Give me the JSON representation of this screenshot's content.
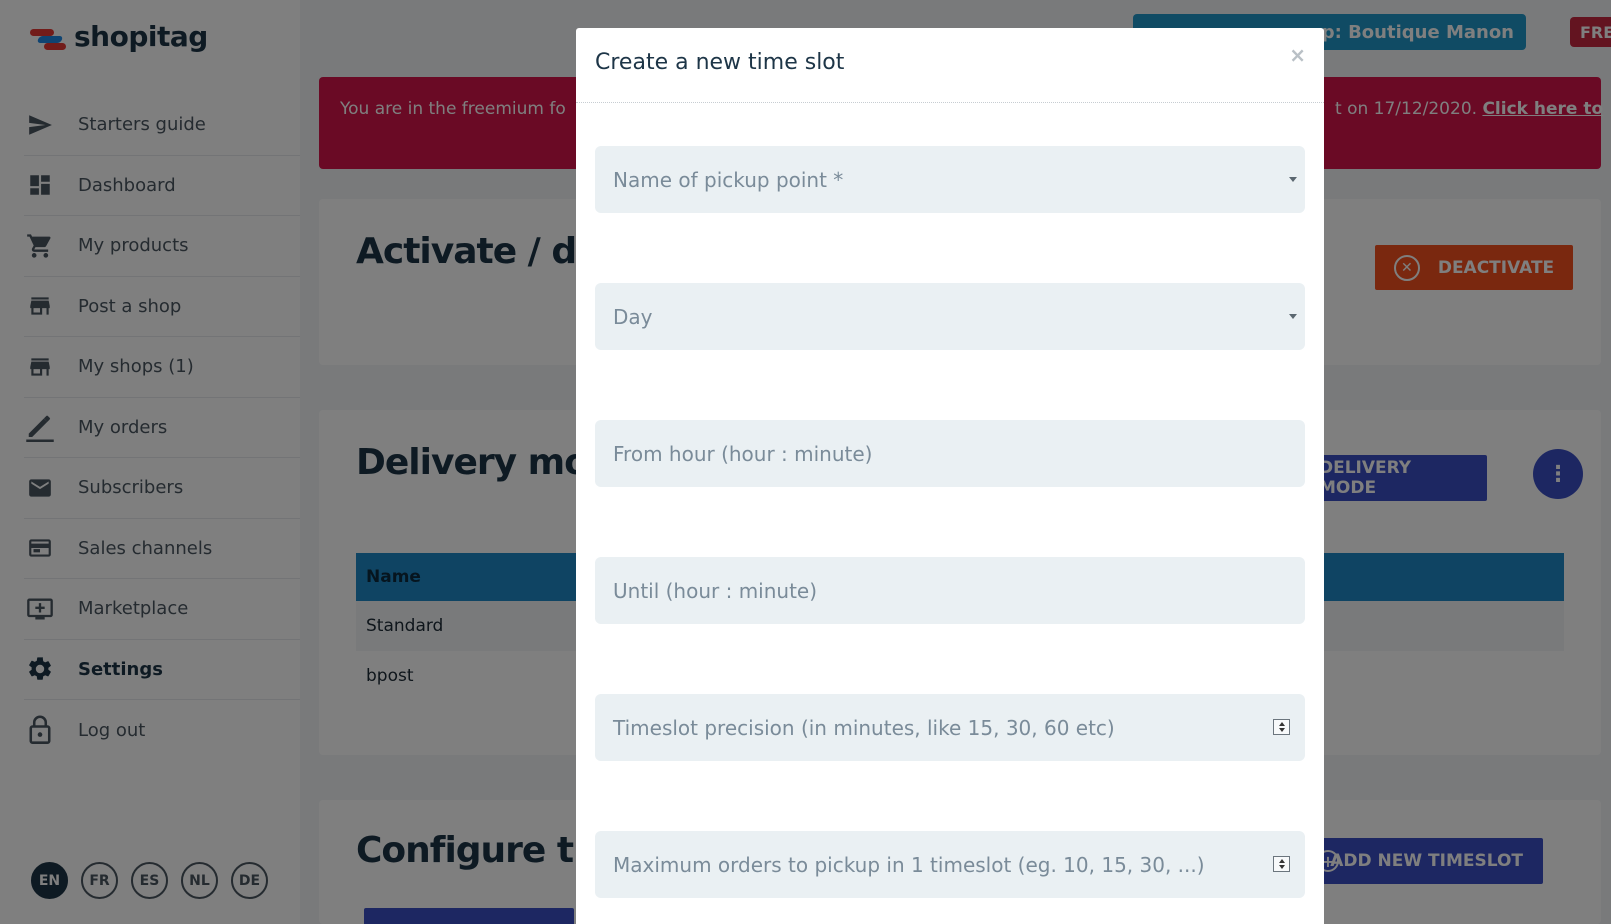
{
  "brand": {
    "name": "shopitag"
  },
  "sidebar": {
    "items": [
      {
        "label": "Starters guide",
        "icon": "send-icon"
      },
      {
        "label": "Dashboard",
        "icon": "dashboard-icon"
      },
      {
        "label": "My products",
        "icon": "cart-icon"
      },
      {
        "label": "Post a shop",
        "icon": "store-icon"
      },
      {
        "label": "My shops (1)",
        "icon": "store-icon"
      },
      {
        "label": "My orders",
        "icon": "pen-icon"
      },
      {
        "label": "Subscribers",
        "icon": "mail-icon"
      },
      {
        "label": "Sales channels",
        "icon": "card-icon"
      },
      {
        "label": "Marketplace",
        "icon": "add-screen-icon"
      },
      {
        "label": "Settings",
        "icon": "gear-icon",
        "active": true
      },
      {
        "label": "Log out",
        "icon": "lock-icon"
      }
    ],
    "languages": [
      "EN",
      "FR",
      "ES",
      "NL",
      "DE"
    ]
  },
  "topbar": {
    "shop_label": "op: Boutique Manon",
    "plan_badge": "FRE"
  },
  "banner": {
    "left_text": "You are in the freemium fo",
    "right_text": "t on 17/12/2020. ",
    "right_link": "Click here to"
  },
  "cards": {
    "activate": {
      "title": "Activate / de",
      "button": "DEACTIVATE"
    },
    "delivery": {
      "title": "Delivery mo",
      "button": "DELIVERY MODE",
      "table": {
        "header": "Name",
        "rows": [
          "Standard",
          "bpost"
        ]
      }
    },
    "configure": {
      "title": "Configure ti",
      "button": "ADD NEW TIMESLOT"
    }
  },
  "modal": {
    "title": "Create a new time slot",
    "close": "×",
    "fields": [
      {
        "placeholder": "Name of pickup point *",
        "type": "select"
      },
      {
        "placeholder": "Day",
        "type": "select"
      },
      {
        "placeholder": "From hour (hour : minute)",
        "type": "text"
      },
      {
        "placeholder": "Until (hour : minute)",
        "type": "text"
      },
      {
        "placeholder": "Timeslot precision (in minutes, like 15, 30, 60 etc)",
        "type": "number"
      },
      {
        "placeholder": "Maximum orders to pickup in 1 timeslot (eg. 10, 15, 30, ...)",
        "type": "number"
      }
    ]
  },
  "colors": {
    "primary": "#3a4fc4",
    "danger": "#f4511e",
    "banner": "#d4144a",
    "table_header": "#1e88c7"
  }
}
